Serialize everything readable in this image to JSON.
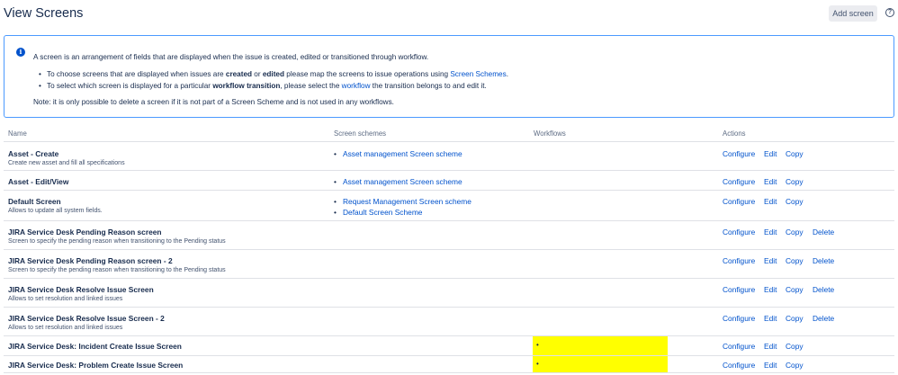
{
  "header": {
    "title": "View Screens",
    "add_button": "Add screen",
    "help_icon": "?"
  },
  "info": {
    "icon": "i",
    "intro": "A screen is an arrangement of fields that are displayed when the issue is created, edited or transitioned through workflow.",
    "b1_pre": "To choose screens that are displayed when issues are ",
    "b1_created": "created",
    "b1_or": " or ",
    "b1_edited": "edited",
    "b1_mid": " please map the screens to issue operations using ",
    "b1_link": "Screen Schemes",
    "b1_end": ".",
    "b2_pre": "To select which screen is displayed for a particular ",
    "b2_bold": "workflow transition",
    "b2_mid": ", please select the ",
    "b2_link": "workflow",
    "b2_end": " the transition belongs to and edit it.",
    "note": "Note: it is only possible to delete a screen if it is not part of a Screen Scheme and is not used in any workflows."
  },
  "table": {
    "headers": {
      "name": "Name",
      "schemes": "Screen schemes",
      "workflows": "Workflows",
      "actions": "Actions"
    },
    "actions": {
      "configure": "Configure",
      "edit": "Edit",
      "copy": "Copy",
      "delete": "Delete"
    },
    "rows": [
      {
        "name": "Asset - Create",
        "desc": "Create new asset and fill all specifications",
        "schemes": [
          "Asset management Screen scheme"
        ]
      },
      {
        "name": "Asset - Edit/View",
        "desc": "",
        "schemes": [
          "Asset management Screen scheme"
        ]
      },
      {
        "name": "Default Screen",
        "desc": "Allows to update all system fields.",
        "schemes": [
          "Request Management Screen scheme",
          "Default Screen Scheme"
        ]
      },
      {
        "name": "JIRA Service Desk Pending Reason screen",
        "desc": "Screen to specify the pending reason when transitioning to the Pending status",
        "schemes": []
      },
      {
        "name": "JIRA Service Desk Pending Reason screen - 2",
        "desc": "Screen to specify the pending reason when transitioning to the Pending status",
        "schemes": []
      },
      {
        "name": "JIRA Service Desk Resolve Issue Screen",
        "desc": "Allows to set resolution and linked issues",
        "schemes": []
      },
      {
        "name": "JIRA Service Desk Resolve Issue Screen - 2",
        "desc": "Allows to set resolution and linked issues",
        "schemes": []
      },
      {
        "name": "JIRA Service Desk: Incident Create Issue Screen",
        "desc": "",
        "schemes": [],
        "workflow": "•"
      },
      {
        "name": "JIRA Service Desk: Problem Create Issue Screen",
        "desc": "",
        "schemes": [],
        "workflow": "•"
      }
    ]
  }
}
